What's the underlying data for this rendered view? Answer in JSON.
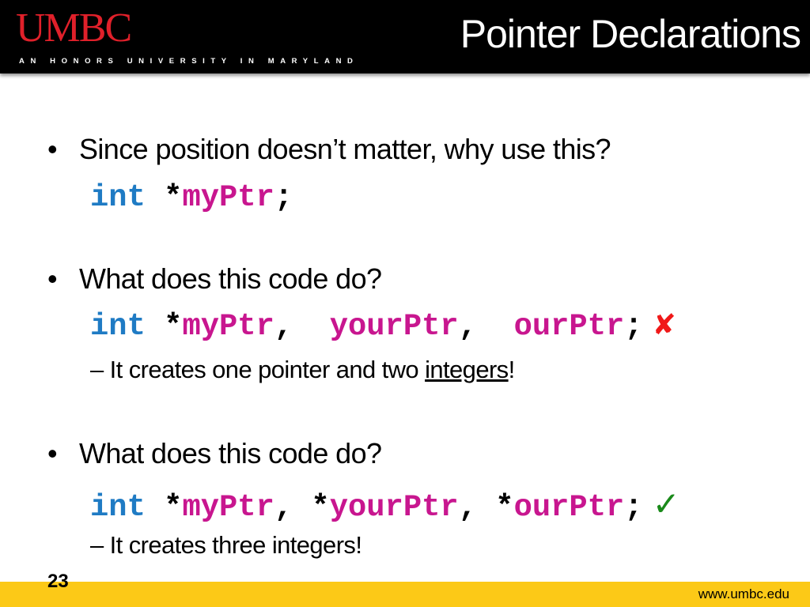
{
  "header": {
    "logo": "UMBC",
    "tagline": "AN HONORS UNIVERSITY IN MARYLAND",
    "title": "Pointer Declarations"
  },
  "bullets": [
    {
      "text": "Since position doesn’t matter, why use this?",
      "code": {
        "kw": "int",
        "p1": " *",
        "id1": "myPtr",
        "p2": ";"
      }
    },
    {
      "text": "What does this code do?",
      "code": {
        "kw": "int",
        "p1": " *",
        "id1": "myPtr",
        "p2": ",  ",
        "id2": "yourPtr",
        "p3": ",  ",
        "id3": "ourPtr",
        "p4": ";"
      },
      "mark": "✘",
      "mark_color": "#f01818",
      "sub": {
        "prefix": "– It creates one pointer and two ",
        "underlined": "integers",
        "suffix": "!"
      }
    },
    {
      "text": "What does this code do?",
      "code": {
        "kw": "int",
        "p1": " *",
        "id1": "myPtr",
        "p2": ", *",
        "id2": "yourPtr",
        "p3": ", *",
        "id3": "ourPtr",
        "p4": ";"
      },
      "mark": "✓",
      "mark_color": "#1a8a1a",
      "sub": {
        "text": "– It creates three integers!"
      }
    }
  ],
  "footer": {
    "page": "23",
    "url": "www.umbc.edu"
  },
  "colors": {
    "keyword": "#1f7bc4",
    "identifier": "#c8168f",
    "footer": "#fcc917",
    "logo": "#e0202a"
  }
}
